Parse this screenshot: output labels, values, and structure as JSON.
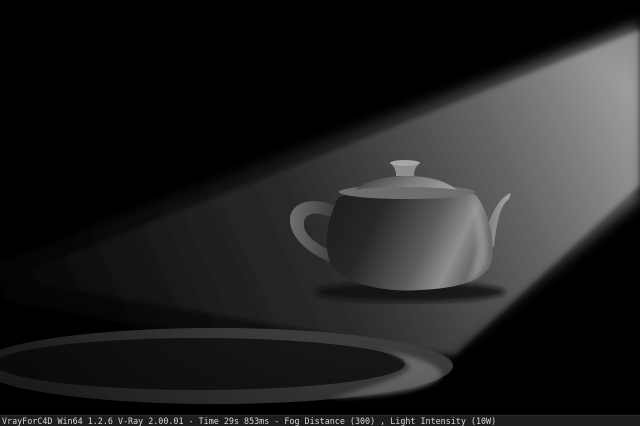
{
  "render": {
    "status_text": "VrayForC4D Win64 1.2.6 V-Ray 2.00.01 - Time 29s 853ms - Fog Distance (300) , Light Intensity (10W)"
  },
  "scene": {
    "subject": "teapot",
    "light": "spotlight-beam",
    "palette": {
      "background": "#000000",
      "beam": "#bdbdbd",
      "teapot_lit": "#8a8a8a",
      "teapot_shadow": "#1a1a1a",
      "floor_pool": "#3a3a3a"
    }
  }
}
